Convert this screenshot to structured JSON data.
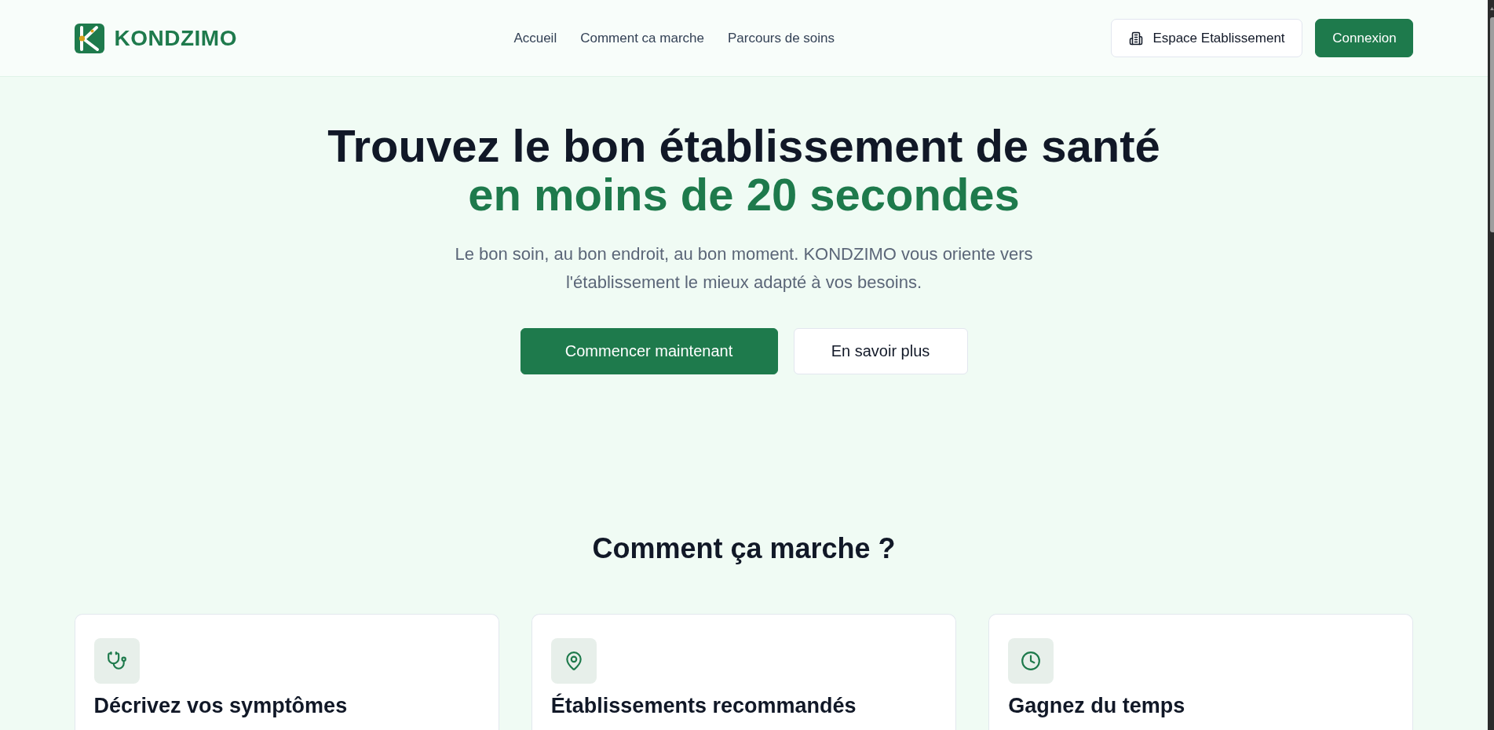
{
  "header": {
    "logo": {
      "text": "KONDZIMO"
    },
    "nav": [
      {
        "label": "Accueil"
      },
      {
        "label": "Comment ca marche"
      },
      {
        "label": "Parcours de soins"
      }
    ],
    "actions": [
      {
        "label": "Espace Etablissement",
        "kind": "outline"
      },
      {
        "label": "Connexion",
        "kind": "primary"
      }
    ]
  },
  "hero": {
    "title": "Trouvez le bon établissement de santé",
    "title_highlight": "en moins de 20 secondes",
    "subtitle": "Le bon soin, au bon endroit, au bon moment. KONDZIMO vous oriente vers l'établissement le mieux adapté à vos besoins.",
    "buttons": [
      {
        "label": "Commencer maintenant",
        "kind": "primary"
      },
      {
        "label": "En savoir plus",
        "kind": "secondary"
      }
    ]
  },
  "how_it_works": {
    "title": "Comment ça marche ?",
    "cards": [
      {
        "title": "Décrivez vos symptômes"
      },
      {
        "title": "Établissements recommandés"
      },
      {
        "title": "Gagnez du temps"
      }
    ]
  }
}
